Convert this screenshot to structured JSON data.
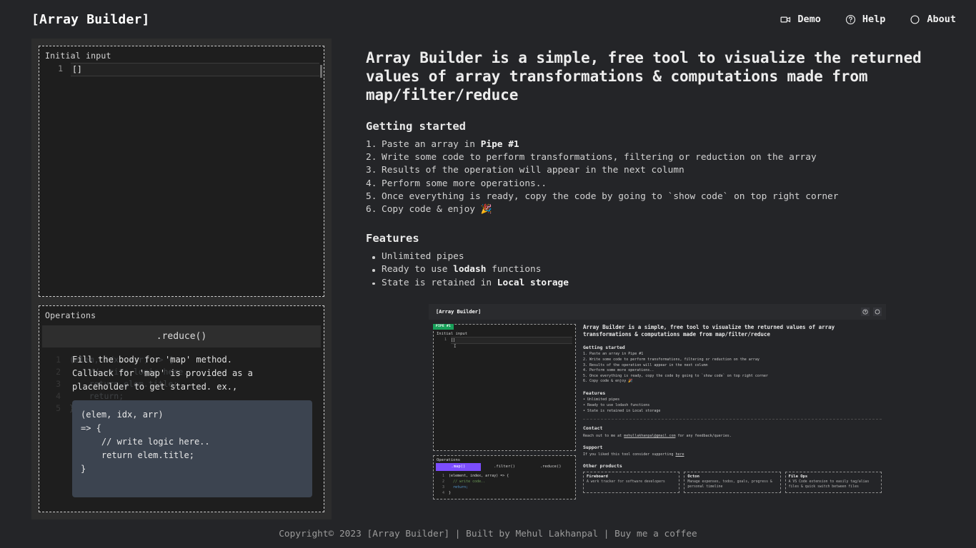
{
  "app": {
    "title": "[Array Builder]"
  },
  "nav": {
    "items": [
      {
        "label": "Demo",
        "icon": "video-camera-icon"
      },
      {
        "label": "Help",
        "icon": "question-circle-icon"
      },
      {
        "label": "About",
        "icon": "circle-icon"
      }
    ]
  },
  "left": {
    "input_panel": {
      "label": "Initial input",
      "line_number": "1",
      "value": "[]"
    },
    "operations_panel": {
      "label": "Operations",
      "active_tab": ".reduce()",
      "ghost_lines": [
        {
          "n": "1",
          "text": "(elem, idx, arr) => {"
        },
        {
          "n": "2",
          "text": "    // write logic here.."
        },
        {
          "n": "3",
          "text": "    return elem.title;"
        },
        {
          "n": "4",
          "text": "    return;"
        },
        {
          "n": "5",
          "text": "}"
        }
      ],
      "tooltip": {
        "line1": "Fill the body for 'map' method.",
        "line2": "Callback for 'map' is provided as a",
        "line3": "placeholder to get started. ex.,",
        "code": "(elem, idx, arr)\n=> {\n    // write logic here..\n    return elem.title;\n}"
      }
    }
  },
  "main": {
    "lede": "Array Builder is a simple, free tool to visualize the returned values of array transformations & computations made from map/filter/reduce",
    "getting_started": {
      "heading": "Getting started",
      "steps": [
        {
          "num": "1.",
          "pre": "Paste an array in ",
          "strong": "Pipe #1",
          "post": ""
        },
        {
          "num": "2.",
          "pre": "Write some code to perform transformations, filtering or reduction on the array",
          "strong": "",
          "post": ""
        },
        {
          "num": "3.",
          "pre": "Results of the operation will appear in the next column",
          "strong": "",
          "post": ""
        },
        {
          "num": "4.",
          "pre": "Perform some more operations..",
          "strong": "",
          "post": ""
        },
        {
          "num": "5.",
          "pre": "Once everything is ready, copy the code by going to `show code` on top right corner",
          "strong": "",
          "post": ""
        },
        {
          "num": "6.",
          "pre": "Copy code & enjoy 🎉",
          "strong": "",
          "post": ""
        }
      ]
    },
    "features": {
      "heading": "Features",
      "items": [
        {
          "pre": "Unlimited pipes",
          "strong": "",
          "post": ""
        },
        {
          "pre": "Ready to use ",
          "strong": "lodash",
          "post": " functions"
        },
        {
          "pre": "State is retained in ",
          "strong": "Local storage",
          "post": ""
        }
      ]
    }
  },
  "preview": {
    "brand": "[Array Builder]",
    "icons": [
      "question-circle-icon",
      "circle-icon"
    ],
    "pipe_badge": "PIPE #1",
    "input_label": "Initial input",
    "input_line_number": "1",
    "input_value": "[]",
    "ops_label": "Operations",
    "tabs": [
      {
        "label": ".map()",
        "active": true
      },
      {
        "label": ".filter()",
        "active": false
      },
      {
        "label": ".reduce()",
        "active": false
      }
    ],
    "ops_code": [
      {
        "n": "1",
        "text": "(element, index, array) => {",
        "cls": ""
      },
      {
        "n": "2",
        "text": "  // write code..",
        "cls": "cm-green"
      },
      {
        "n": "3",
        "text": "  return;",
        "cls": "cm-blue"
      },
      {
        "n": "4",
        "text": "}",
        "cls": ""
      }
    ],
    "lede": "Array Builder is a simple, free tool to visualize the returned values of array transformations & computations made from map/filter/reduce",
    "getting_started_heading": "Getting started",
    "getting_started": [
      "1. Paste an array in Pipe #1",
      "2. Write some code to perform transformations, filtering or reduction on the array",
      "3. Results of the operation will appear in the next column",
      "4. Perform some more operations..",
      "5. Once everything is ready, copy the code by going to `show code` on top right corner",
      "6. Copy code & enjoy 🎉"
    ],
    "features_heading": "Features",
    "features": [
      "• Unlimited pipes",
      "• Ready to use lodash functions",
      "• State is retained in Local storage"
    ],
    "contact_heading": "Contact",
    "contact_pre": "Reach out to me at ",
    "contact_link": "mehullakhanpal@gmail.com",
    "contact_post": " for any feedback/queries.",
    "support_heading": "Support",
    "support_pre": "If you liked this tool consider supporting ",
    "support_link": "here",
    "products_heading": "Other products",
    "products": [
      {
        "title": "Fireboard",
        "desc": "A work tracker for software developers"
      },
      {
        "title": "Octon",
        "desc": "Manage expenses, todos, goals, progress & personal timeline"
      },
      {
        "title": "File Ops",
        "desc": "A VS Code extension to easily tag/alias files & quick switch between files"
      }
    ]
  },
  "footer": {
    "text": "Copyright© 2023 [Array Builder] | Built by Mehul Lakhanpal | Buy me a coffee"
  },
  "colors": {
    "page_bg": "#242528",
    "panel_bg": "#2d2d2d",
    "editor_bg": "#1e1e1e",
    "accent_purple": "#7c4dff",
    "badge_green": "#19a05a",
    "text": "#d8d8d8"
  }
}
